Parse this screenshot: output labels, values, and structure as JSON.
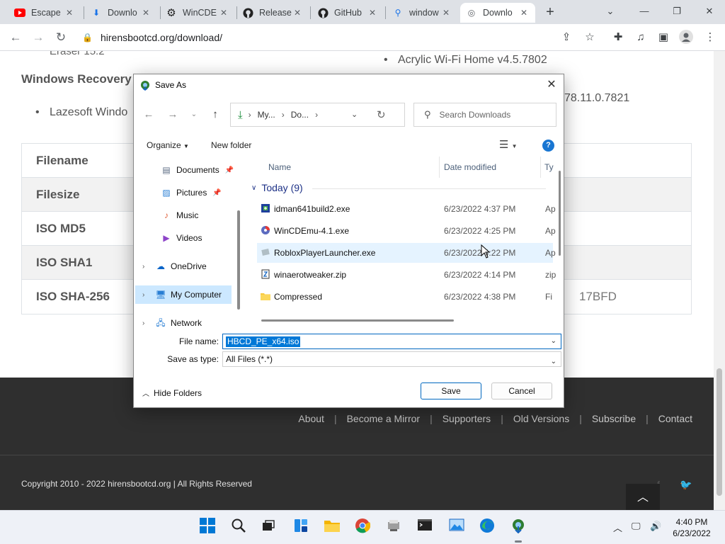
{
  "browser": {
    "tabs": [
      {
        "icon": "youtube-icon",
        "label": "Escape"
      },
      {
        "icon": "download-icon",
        "label": "Downlo"
      },
      {
        "icon": "gear-icon",
        "label": "WinCDE"
      },
      {
        "icon": "github-icon",
        "label": "Release"
      },
      {
        "icon": "github-icon",
        "label": "GitHub"
      },
      {
        "icon": "search-icon",
        "label": "window"
      },
      {
        "icon": "globe-icon",
        "label": "Downlo"
      }
    ],
    "url": "hirensbootcd.org/download/"
  },
  "page": {
    "eraser_text": "Eraser 15.2",
    "recovery_heading": "Windows Recovery",
    "bullet_lazesoft": "Lazesoft Windo",
    "bullet_acrylic": "Acrylic Wi-Fi Home v4.5.7802",
    "bullet_version_tail": "78.11.0.7821",
    "table_rows": [
      {
        "label": "Filename",
        "value": ""
      },
      {
        "label": "Filesize",
        "value": ""
      },
      {
        "label": "ISO MD5",
        "value": ""
      },
      {
        "label": "ISO SHA1",
        "value": ""
      },
      {
        "label": "ISO SHA-256",
        "value": "17BFD"
      }
    ],
    "footer_links": [
      "About",
      "Become a Mirror",
      "Supporters",
      "Old Versions",
      "Subscribe",
      "Contact"
    ],
    "copyright": "Copyright 2010 - 2022 hirensbootcd.org | All Rights Reserved"
  },
  "dialog": {
    "title": "Save As",
    "address": {
      "crumb1": "My...",
      "crumb2": "Do..."
    },
    "search_placeholder": "Search Downloads",
    "organize_label": "Organize",
    "new_folder_label": "New folder",
    "nav_items": [
      {
        "label": "Documents",
        "icon": "documents-icon",
        "pinned": true
      },
      {
        "label": "Pictures",
        "icon": "pictures-icon",
        "pinned": true
      },
      {
        "label": "Music",
        "icon": "music-icon",
        "pinned": false
      },
      {
        "label": "Videos",
        "icon": "videos-icon",
        "pinned": false
      },
      {
        "label": "OneDrive",
        "icon": "cloud-icon",
        "pinned": false
      },
      {
        "label": "My Computer",
        "icon": "computer-icon",
        "pinned": false
      },
      {
        "label": "Network",
        "icon": "network-icon",
        "pinned": false
      }
    ],
    "columns": {
      "name": "Name",
      "date": "Date modified",
      "type": "Ty"
    },
    "group_label": "Today (9)",
    "files": [
      {
        "name": "idman641build2.exe",
        "date": "6/23/2022 4:37 PM",
        "type": "Ap",
        "icon": "installer-icon"
      },
      {
        "name": "WinCDEmu-4.1.exe",
        "date": "6/23/2022 4:25 PM",
        "type": "Ap",
        "icon": "disc-icon"
      },
      {
        "name": "RobloxPlayerLauncher.exe",
        "date": "6/23/2022 4:22 PM",
        "type": "Ap",
        "icon": "roblox-icon"
      },
      {
        "name": "winaerotweaker.zip",
        "date": "6/23/2022 4:14 PM",
        "type": "zip",
        "icon": "zip-icon"
      },
      {
        "name": "Compressed",
        "date": "6/23/2022 4:38 PM",
        "type": "Fi",
        "icon": "folder-icon"
      }
    ],
    "file_name_label": "File name:",
    "file_name_value": "HBCD_PE_x64.iso",
    "save_type_label": "Save as type:",
    "save_type_value": "All Files (*.*)",
    "hide_folders_label": "Hide Folders",
    "save_label": "Save",
    "cancel_label": "Cancel"
  },
  "taskbar": {
    "time": "4:40 PM",
    "date": "6/23/2022"
  }
}
